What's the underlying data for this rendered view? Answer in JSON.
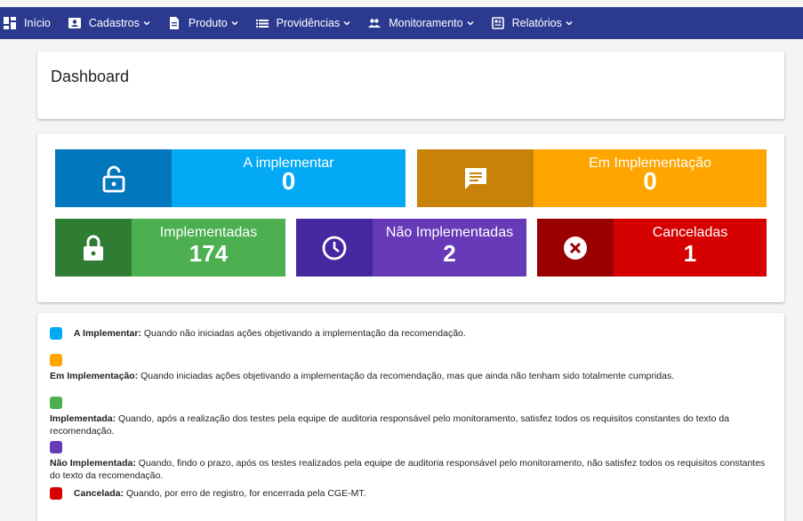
{
  "nav": {
    "home": "Início",
    "cadastros": "Cadastros",
    "produto": "Produto",
    "providencias": "Providências",
    "monitoramento": "Monitoramento",
    "relatorios": "Relatórios"
  },
  "dashboard": {
    "title": "Dashboard"
  },
  "stats": {
    "a_implementar": {
      "label": "A implementar",
      "value": "0",
      "color": "#03a9f4",
      "dark": "#0277bd"
    },
    "em_implementacao": {
      "label": "Em Implementação",
      "value": "0",
      "color": "#ffa500",
      "dark": "#c8820a"
    },
    "implementadas": {
      "label": "Implementadas",
      "value": "174",
      "color": "#4caf50",
      "dark": "#2e7d32"
    },
    "nao_implementadas": {
      "label": "Não Implementadas",
      "value": "2",
      "color": "#673ab7",
      "dark": "#4527a0"
    },
    "canceladas": {
      "label": "Canceladas",
      "value": "1",
      "color": "#d50000",
      "dark": "#9b0000"
    }
  },
  "legend": {
    "a_implementar": {
      "term": "A Implementar:",
      "text": " Quando não iniciadas ações objetivando a implementação da recomendação."
    },
    "em_implementacao": {
      "term": "Em Implementação:",
      "text": " Quando iniciadas ações objetivando a implementação da recomendação, mas que ainda não tenham sido totalmente cumpridas."
    },
    "implementada": {
      "term": "Implementada:",
      "text": " Quando, após a realização dos testes pela equipe de auditoria responsável pelo monitoramento, satisfez todos os requisitos constantes do texto da recomendação."
    },
    "nao_implementada": {
      "term": "Não Implementada:",
      "text": " Quando, findo o prazo, após os testes realizados pela equipe de auditoria responsável pelo monitoramento, não satisfez todos os requisitos constantes do texto da recomendação."
    },
    "cancelada": {
      "term": "Cancelada:",
      "text": " Quando, por erro de registro, for encerrada pela CGE-MT."
    }
  }
}
